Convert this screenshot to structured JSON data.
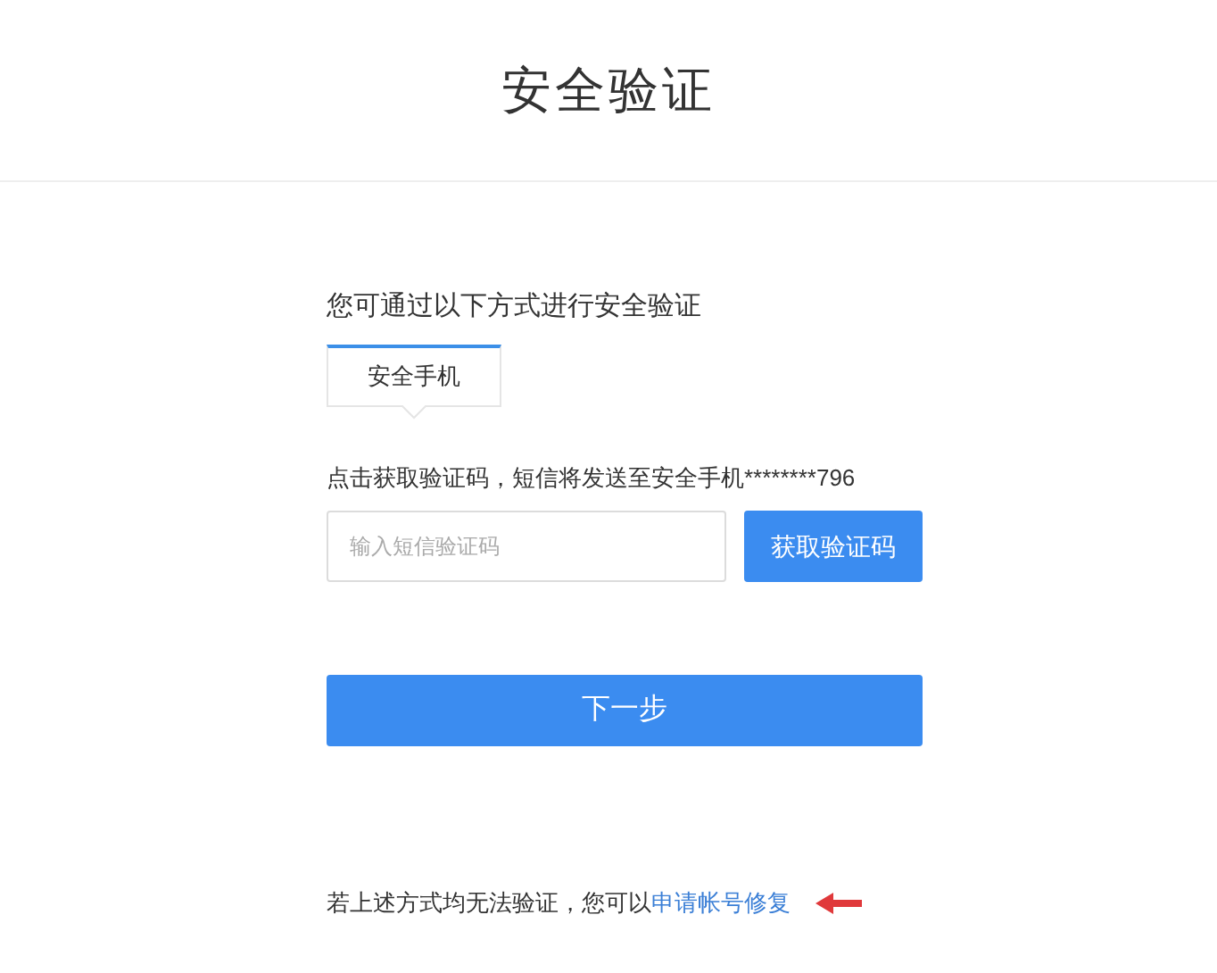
{
  "header": {
    "title": "安全验证"
  },
  "intro": "您可通过以下方式进行安全验证",
  "methods": [
    {
      "label": "安全手机",
      "selected": true
    }
  ],
  "notice": "点击获取验证码，短信将发送至安全手机********796",
  "code_field": {
    "placeholder": "输入短信验证码"
  },
  "get_code_button": "获取验证码",
  "next_button": "下一步",
  "footer": {
    "text": "若上述方式均无法验证，您可以",
    "link": "申请帐号修复"
  }
}
